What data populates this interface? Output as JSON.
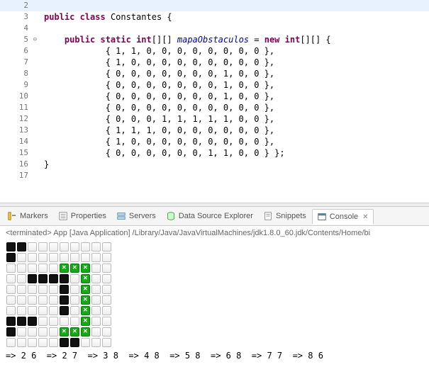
{
  "editor": {
    "lines": [
      {
        "num": 2,
        "hl": true,
        "tokens": []
      },
      {
        "num": 3,
        "tokens": [
          {
            "t": "public ",
            "c": "kw"
          },
          {
            "t": "class ",
            "c": "kw"
          },
          {
            "t": "Constantes {",
            "c": "plain"
          }
        ]
      },
      {
        "num": 4,
        "tokens": []
      },
      {
        "num": 5,
        "fold": true,
        "tokens": [
          {
            "t": "    ",
            "c": "plain"
          },
          {
            "t": "public ",
            "c": "kw"
          },
          {
            "t": "static ",
            "c": "kw"
          },
          {
            "t": "int",
            "c": "kw"
          },
          {
            "t": "[][] ",
            "c": "plain"
          },
          {
            "t": "mapaObstaculos",
            "c": "field"
          },
          {
            "t": " = ",
            "c": "plain"
          },
          {
            "t": "new ",
            "c": "kw"
          },
          {
            "t": "int",
            "c": "kw"
          },
          {
            "t": "[][] {",
            "c": "plain"
          }
        ]
      },
      {
        "num": 6,
        "tokens": [
          {
            "t": "            { 1, 1, 0, 0, 0, 0, 0, 0, 0, 0 },",
            "c": "plain"
          }
        ]
      },
      {
        "num": 7,
        "tokens": [
          {
            "t": "            { 1, 0, 0, 0, 0, 0, 0, 0, 0, 0 },",
            "c": "plain"
          }
        ]
      },
      {
        "num": 8,
        "tokens": [
          {
            "t": "            { 0, 0, 0, 0, 0, 0, 0, 1, 0, 0 },",
            "c": "plain"
          }
        ]
      },
      {
        "num": 9,
        "tokens": [
          {
            "t": "            { 0, 0, 0, 0, 0, 0, 0, 1, 0, 0 },",
            "c": "plain"
          }
        ]
      },
      {
        "num": 10,
        "tokens": [
          {
            "t": "            { 0, 0, 0, 0, 0, 0, 0, 1, 0, 0 },",
            "c": "plain"
          }
        ]
      },
      {
        "num": 11,
        "tokens": [
          {
            "t": "            { 0, 0, 0, 0, 0, 0, 0, 0, 0, 0 },",
            "c": "plain"
          }
        ]
      },
      {
        "num": 12,
        "tokens": [
          {
            "t": "            { 0, 0, 0, 1, 1, 1, 1, 1, 0, 0 },",
            "c": "plain"
          }
        ]
      },
      {
        "num": 13,
        "tokens": [
          {
            "t": "            { 1, 1, 1, 0, 0, 0, 0, 0, 0, 0 },",
            "c": "plain"
          }
        ]
      },
      {
        "num": 14,
        "tokens": [
          {
            "t": "            { 1, 0, 0, 0, 0, 0, 0, 0, 0, 0 },",
            "c": "plain"
          }
        ]
      },
      {
        "num": 15,
        "tokens": [
          {
            "t": "            { 0, 0, 0, 0, 0, 0, 1, 1, 0, 0 } };",
            "c": "plain"
          }
        ]
      },
      {
        "num": 16,
        "tokens": [
          {
            "t": "}",
            "c": "plain"
          }
        ]
      },
      {
        "num": 17,
        "tokens": []
      }
    ]
  },
  "tabs": {
    "items": [
      {
        "label": "Markers",
        "icon": "markers"
      },
      {
        "label": "Properties",
        "icon": "properties"
      },
      {
        "label": "Servers",
        "icon": "servers"
      },
      {
        "label": "Data Source Explorer",
        "icon": "datasource"
      },
      {
        "label": "Snippets",
        "icon": "snippets"
      },
      {
        "label": "Console",
        "icon": "console",
        "active": true,
        "closable": true
      }
    ]
  },
  "console": {
    "header": "<terminated> App [Java Application] /Library/Java/JavaVirtualMachines/jdk1.8.0_60.jdk/Contents/Home/bi",
    "grid": [
      [
        "B",
        "B",
        "E",
        "E",
        "E",
        "E",
        "E",
        "E",
        "E",
        "E"
      ],
      [
        "B",
        "E",
        "E",
        "E",
        "E",
        "E",
        "E",
        "E",
        "E",
        "E"
      ],
      [
        "E",
        "E",
        "E",
        "E",
        "E",
        "G",
        "G",
        "G",
        "E",
        "E"
      ],
      [
        "E",
        "E",
        "B",
        "B",
        "B",
        "B",
        "E",
        "G",
        "E",
        "E"
      ],
      [
        "E",
        "E",
        "E",
        "E",
        "E",
        "B",
        "E",
        "G",
        "E",
        "E"
      ],
      [
        "E",
        "E",
        "E",
        "E",
        "E",
        "B",
        "E",
        "G",
        "E",
        "E"
      ],
      [
        "E",
        "E",
        "E",
        "E",
        "E",
        "B",
        "E",
        "G",
        "E",
        "E"
      ],
      [
        "B",
        "B",
        "B",
        "E",
        "E",
        "E",
        "E",
        "G",
        "E",
        "E"
      ],
      [
        "B",
        "E",
        "E",
        "E",
        "E",
        "G",
        "G",
        "G",
        "E",
        "E"
      ],
      [
        "E",
        "E",
        "E",
        "E",
        "E",
        "B",
        "B",
        "E",
        "E",
        "E"
      ]
    ],
    "path": "=> 2 6  => 2 7  => 3 8  => 4 8  => 5 8  => 6 8  => 7 7  => 8 6"
  }
}
